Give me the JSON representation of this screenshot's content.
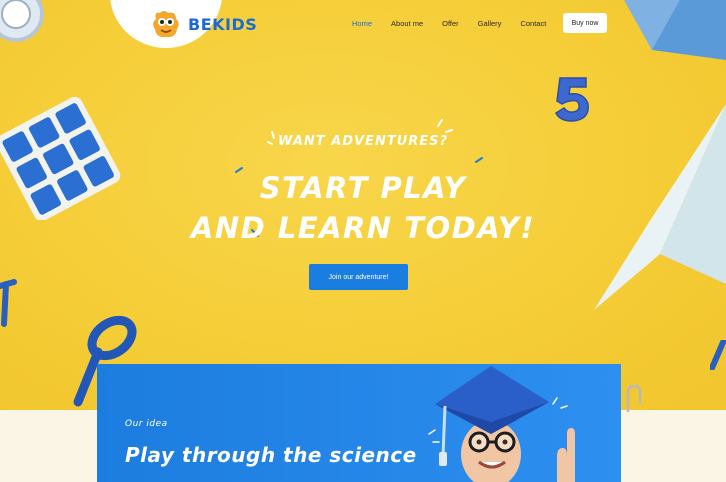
{
  "brand": {
    "name": "BEKIDS",
    "logo_icon": "monster-mascot-icon"
  },
  "nav": {
    "items": [
      "Home",
      "About me",
      "Offer",
      "Gallery",
      "Contact"
    ],
    "active_index": 0,
    "buy_label": "Buy now"
  },
  "hero": {
    "eyebrow": "WANT ADVENTURES?",
    "headline_line1": "START PLAY",
    "headline_line2": "AND LEARN TODAY!",
    "cta_label": "Join our adventure!"
  },
  "idea": {
    "kicker": "Our idea",
    "title": "Play through the science"
  },
  "colors": {
    "accent_blue": "#1a7de0",
    "hero_yellow": "#f5ce3a",
    "bottom_cream": "#fbf5e6"
  }
}
